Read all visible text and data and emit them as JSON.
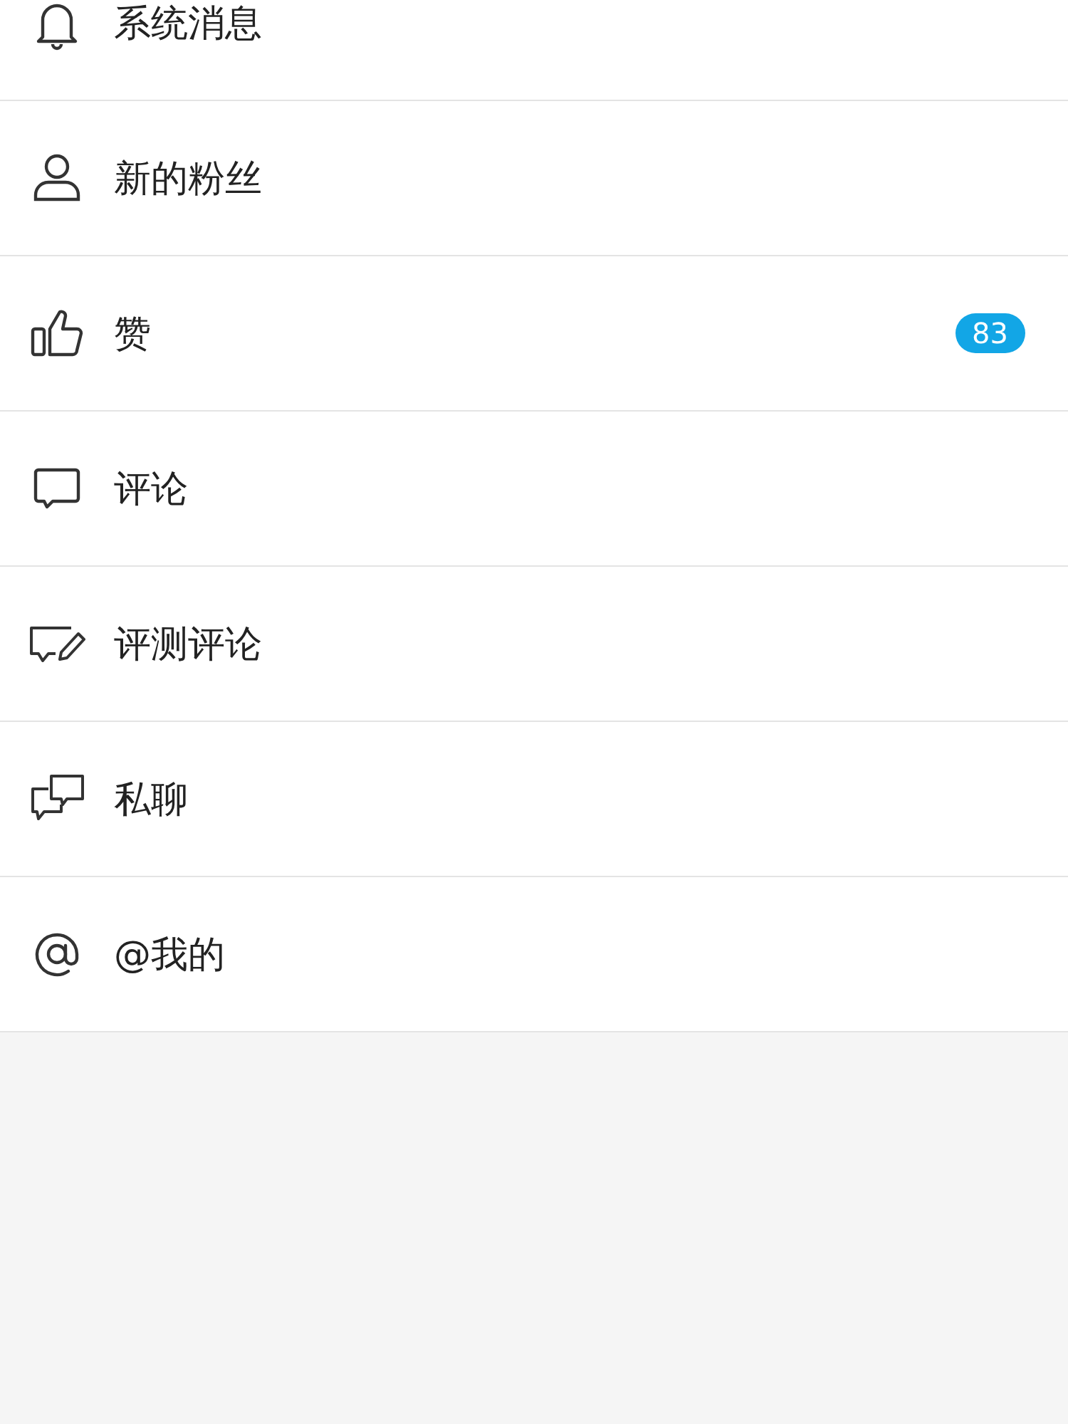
{
  "items": [
    {
      "kind": "bell",
      "label": "系统消息"
    },
    {
      "kind": "person",
      "label": "新的粉丝"
    },
    {
      "kind": "thumb",
      "label": "赞",
      "badge": "83"
    },
    {
      "kind": "comment",
      "label": "评论"
    },
    {
      "kind": "review",
      "label": "评测评论"
    },
    {
      "kind": "chat",
      "label": "私聊"
    },
    {
      "kind": "at",
      "label": "@我的"
    }
  ]
}
